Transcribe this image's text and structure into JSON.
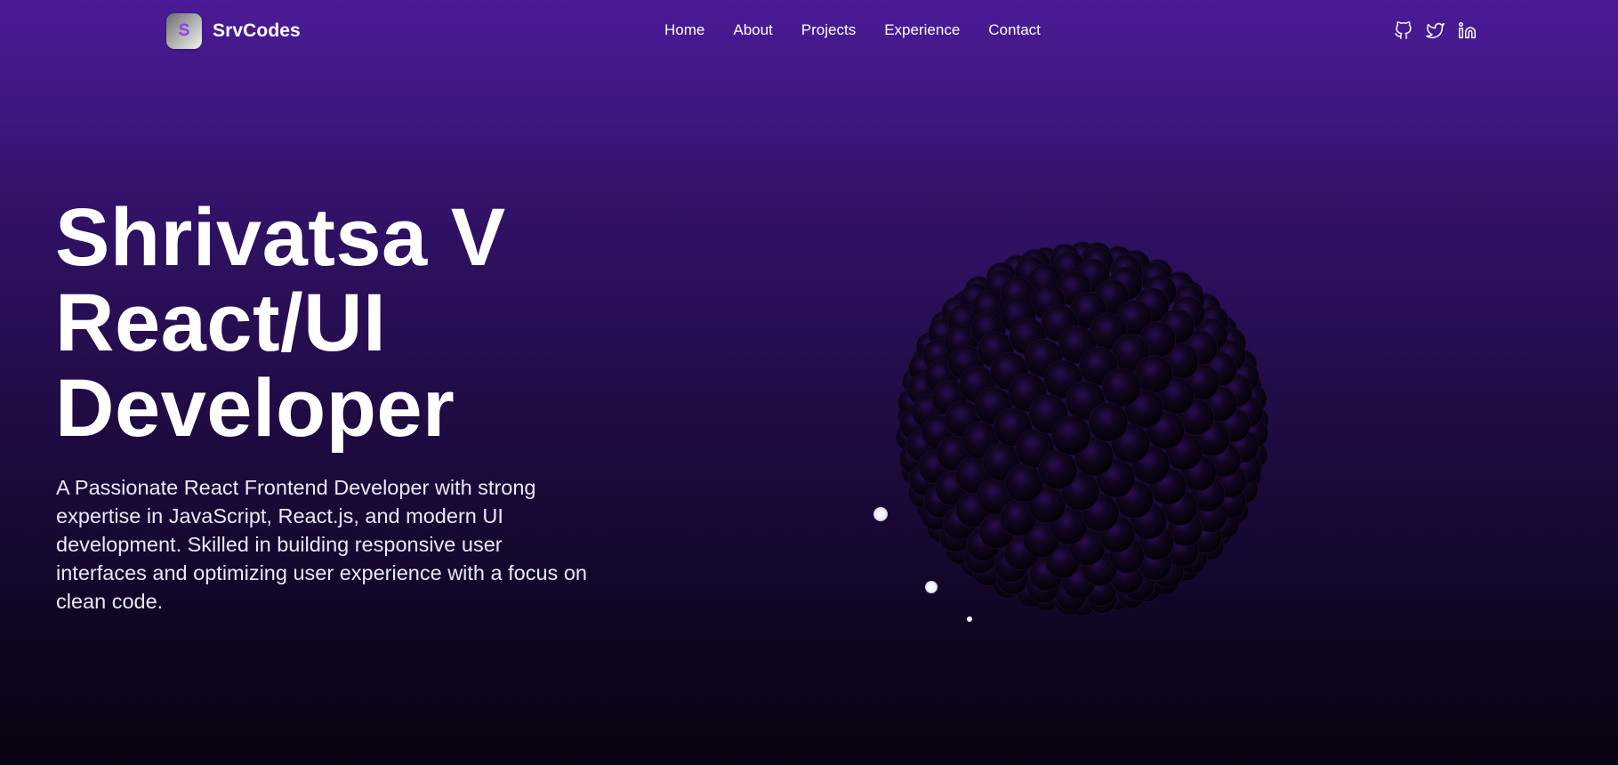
{
  "brand": {
    "logo_letter": "S",
    "name": "SrvCodes",
    "logo_color": "#8b3ff1"
  },
  "nav": {
    "links": [
      "Home",
      "About",
      "Projects",
      "Experience",
      "Contact"
    ]
  },
  "social": {
    "icons": [
      "github-icon",
      "twitter-icon",
      "linkedin-icon"
    ]
  },
  "hero": {
    "title_line1": "Shrivatsa V",
    "title_line2": "React/UI",
    "title_line3": "Developer",
    "description": "A Passionate React Frontend Developer with strong expertise in JavaScript, React.js, and modern UI development. Skilled in building responsive user interfaces and optimizing user experience with a focus on clean code."
  },
  "colors": {
    "background_top": "#4b1a98",
    "background_bottom": "#07030f",
    "sphere_ball": "#08030f",
    "sphere_highlight": "#2e0f5c",
    "text": "#ffffff"
  }
}
